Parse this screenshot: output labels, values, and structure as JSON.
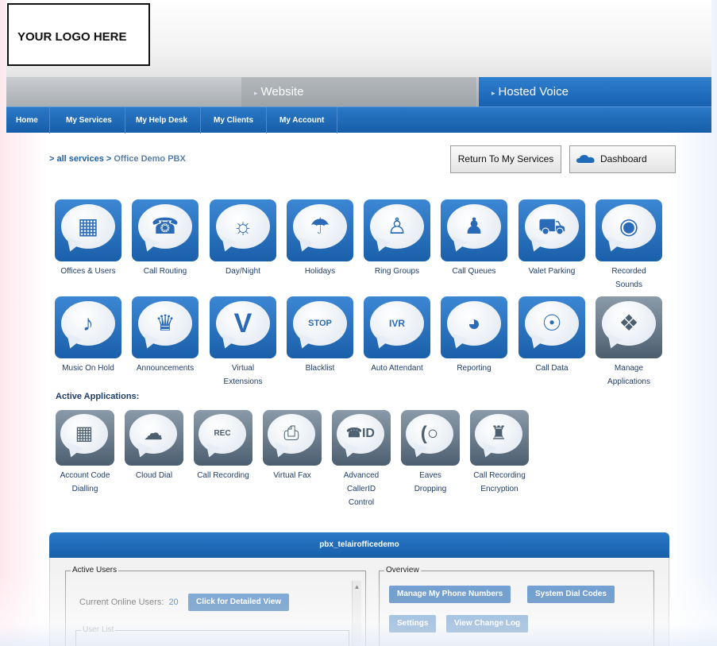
{
  "header": {
    "logo_text": "YOUR LOGO HERE",
    "tabs": [
      {
        "label": "Website"
      },
      {
        "label": "Hosted Voice"
      }
    ]
  },
  "nav": {
    "items": [
      "Home",
      "My Services",
      "My Help Desk",
      "My Clients",
      "My Account"
    ]
  },
  "breadcrumb": {
    "root": "> all services >",
    "current": "Office Demo PBX"
  },
  "actions": {
    "return_label": "Return To My Services",
    "dashboard_label": "Dashboard"
  },
  "services_row1": [
    {
      "label": "Offices & Users",
      "icon": "building-icon"
    },
    {
      "label": "Call Routing",
      "icon": "call-routing-icon"
    },
    {
      "label": "Day/Night",
      "icon": "sun-moon-icon"
    },
    {
      "label": "Holidays",
      "icon": "umbrella-icon"
    },
    {
      "label": "Ring Groups",
      "icon": "group-icon"
    },
    {
      "label": "Call Queues",
      "icon": "queue-icon"
    },
    {
      "label": "Valet Parking",
      "icon": "car-icon"
    },
    {
      "label": "Recorded Sounds",
      "icon": "speaker-icon"
    }
  ],
  "services_row2": [
    {
      "label": "Music On Hold",
      "icon": "music-note-icon"
    },
    {
      "label": "Announcements",
      "icon": "announcer-icon"
    },
    {
      "label": "Virtual Extensions",
      "icon": "v-letter-icon"
    },
    {
      "label": "Blacklist",
      "icon": "stop-icon"
    },
    {
      "label": "Auto Attendant",
      "icon": "ivr-icon"
    },
    {
      "label": "Reporting",
      "icon": "pie-chart-icon"
    },
    {
      "label": "Call Data",
      "icon": "eye-phone-icon"
    },
    {
      "label": "Manage Applications",
      "icon": "puzzle-icon"
    }
  ],
  "active_apps_title": "Active Applications:",
  "active_apps": [
    {
      "label": "Account Code Dialling",
      "icon": "account-code-icon"
    },
    {
      "label": "Cloud Dial",
      "icon": "cloud-dial-icon"
    },
    {
      "label": "Call Recording",
      "icon": "rec-icon"
    },
    {
      "label": "Virtual Fax",
      "icon": "fax-icon"
    },
    {
      "label": "Advanced CallerID Control",
      "icon": "caller-id-icon"
    },
    {
      "label": "Eaves Dropping",
      "icon": "ear-icon"
    },
    {
      "label": "Call Recording Encryption",
      "icon": "shield-phone-icon"
    }
  ],
  "panel": {
    "title": "pbx_telairofficedemo",
    "active_users_legend": "Active Users",
    "online_label": "Current Online Users:",
    "online_count": "20",
    "detail_button": "Click for Detailed View",
    "user_list_legend": "User List",
    "overview_legend": "Overview",
    "overview_buttons": [
      "Manage My Phone Numbers",
      "System Dial Codes",
      "Settings",
      "View Change Log"
    ]
  },
  "colors": {
    "brand_blue": "#1f6bb9",
    "nav_blue": "#165da8",
    "text_dark": "#1f3d66"
  }
}
